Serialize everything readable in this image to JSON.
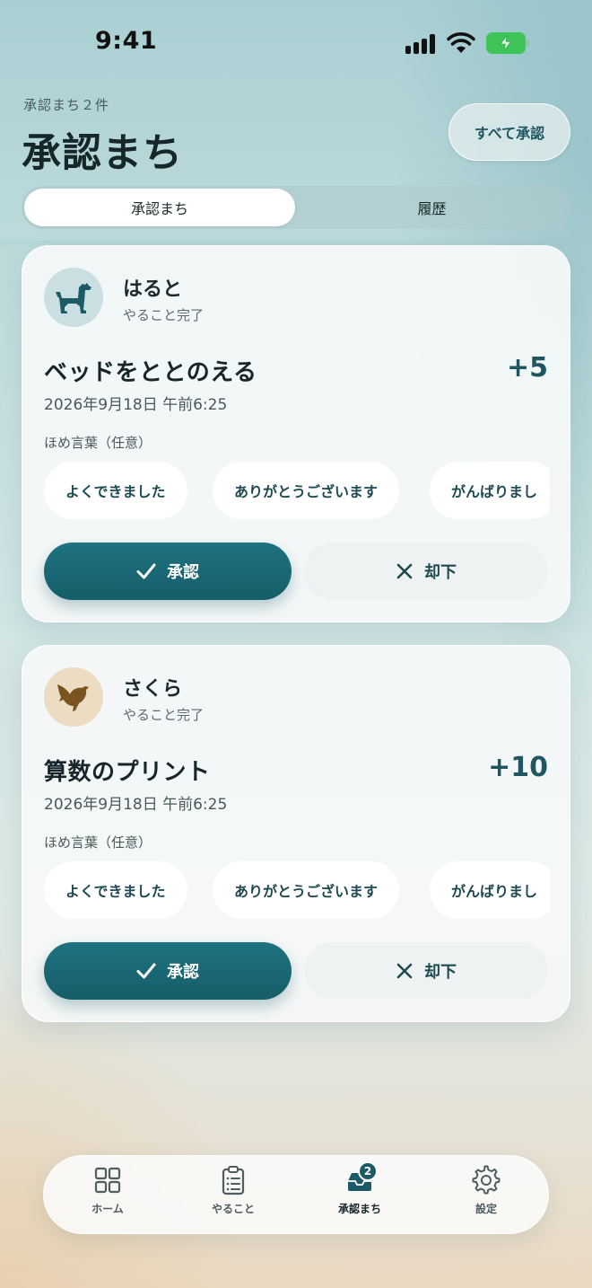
{
  "status_bar": {
    "time": "9:41"
  },
  "header": {
    "subtitle": "承認まち２件",
    "title": "承認まち",
    "approve_all_label": "すべて承認"
  },
  "segments": [
    {
      "label": "承認まち",
      "active": true
    },
    {
      "label": "履歴",
      "active": false
    }
  ],
  "cards": [
    {
      "child_name": "はると",
      "child_status": "やること完了",
      "avatar_icon": "dog-icon",
      "task_title": "ベッドをととのえる",
      "points": "+5",
      "date": "2026年9月18日 午前6:25",
      "praise_label": "ほめ言葉（任意）",
      "praise_options": [
        "よくできました",
        "ありがとうございます",
        "がんばりまし"
      ],
      "approve_label": "承認",
      "reject_label": "却下"
    },
    {
      "child_name": "さくら",
      "child_status": "やること完了",
      "avatar_icon": "bird-icon",
      "task_title": "算数のプリント",
      "points": "+10",
      "date": "2026年9月18日 午前6:25",
      "praise_label": "ほめ言葉（任意）",
      "praise_options": [
        "よくできました",
        "ありがとうございます",
        "がんばりまし"
      ],
      "approve_label": "承認",
      "reject_label": "却下"
    }
  ],
  "tabbar": {
    "items": [
      {
        "label": "ホーム",
        "icon": "home-grid-icon"
      },
      {
        "label": "やること",
        "icon": "clipboard-list-icon"
      },
      {
        "label": "承認まち",
        "icon": "inbox-tray-icon",
        "badge": "2",
        "active": true
      },
      {
        "label": "設定",
        "icon": "gear-icon"
      }
    ]
  },
  "colors": {
    "accent": "#1b6673",
    "battery": "#3fc45a"
  }
}
